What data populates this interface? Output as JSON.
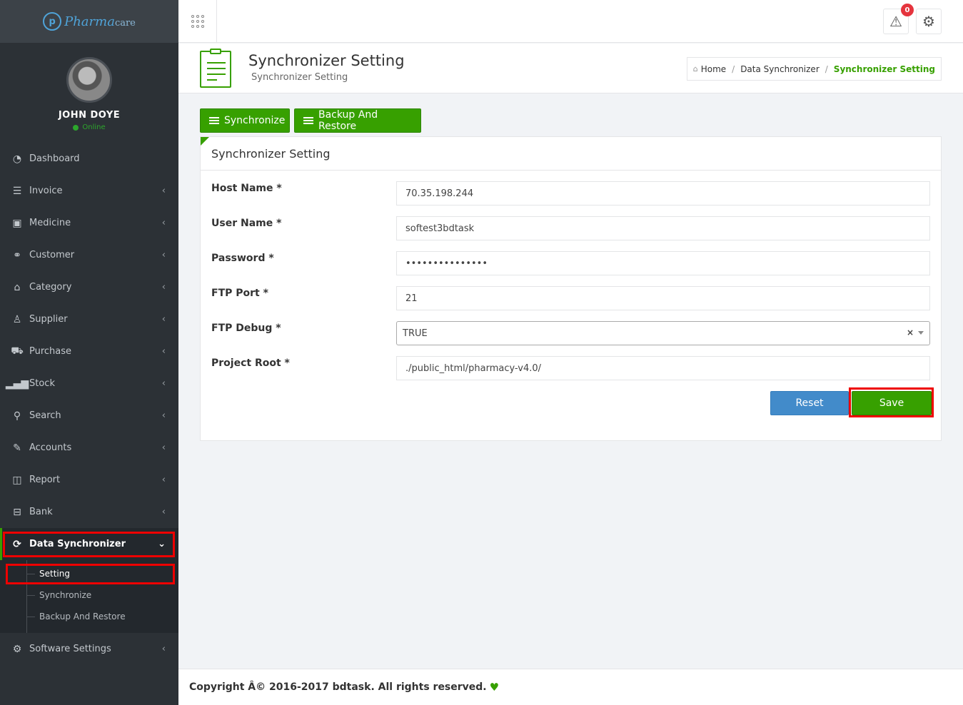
{
  "app": {
    "logo_text": "Pharma",
    "logo_text_suffix": "care",
    "logo_letter": "p"
  },
  "profile": {
    "name": "JOHN DOYE",
    "status": "Online"
  },
  "sidebar": {
    "items": [
      {
        "label": "Dashboard",
        "icon": "dashboard-icon"
      },
      {
        "label": "Invoice",
        "icon": "invoice-icon"
      },
      {
        "label": "Medicine",
        "icon": "medicine-icon"
      },
      {
        "label": "Customer",
        "icon": "handshake-icon"
      },
      {
        "label": "Category",
        "icon": "bookmark-icon"
      },
      {
        "label": "Supplier",
        "icon": "user-icon"
      },
      {
        "label": "Purchase",
        "icon": "cart-icon"
      },
      {
        "label": "Stock",
        "icon": "bar-chart-icon"
      },
      {
        "label": "Search",
        "icon": "search-icon"
      },
      {
        "label": "Accounts",
        "icon": "edit-icon"
      },
      {
        "label": "Report",
        "icon": "book-icon"
      },
      {
        "label": "Bank",
        "icon": "briefcase-icon"
      },
      {
        "label": "Data Synchronizer",
        "icon": "sync-icon"
      },
      {
        "label": "Software Settings",
        "icon": "gear-icon"
      }
    ],
    "submenu": [
      "Setting",
      "Synchronize",
      "Backup And Restore"
    ]
  },
  "header": {
    "notification_count": "0"
  },
  "page": {
    "title": "Synchronizer Setting",
    "subtitle": "Synchronizer Setting",
    "breadcrumb": [
      "Home",
      "Data Synchronizer",
      "Synchronizer Setting"
    ]
  },
  "tabs": [
    "Synchronize",
    "Backup And Restore"
  ],
  "form": {
    "title": "Synchronizer Setting",
    "fields": [
      {
        "label": "Host Name *",
        "value": "70.35.198.244"
      },
      {
        "label": "User Name *",
        "value": "softest3bdtask"
      },
      {
        "label": "Password *",
        "value": "•••••••••••••••"
      },
      {
        "label": "FTP Port *",
        "value": "21"
      },
      {
        "label": "FTP Debug *",
        "value": "TRUE"
      },
      {
        "label": "Project Root *",
        "value": "./public_html/pharmacy-v4.0/"
      }
    ],
    "reset_label": "Reset",
    "save_label": "Save"
  },
  "footer": {
    "copyright": "Copyright Â© 2016-2017 bdtask. All rights reserved."
  },
  "colors": {
    "accent": "#37a000",
    "sidebar_bg": "#2c3136",
    "reset_btn": "#428bca",
    "highlight": "#e00000"
  }
}
